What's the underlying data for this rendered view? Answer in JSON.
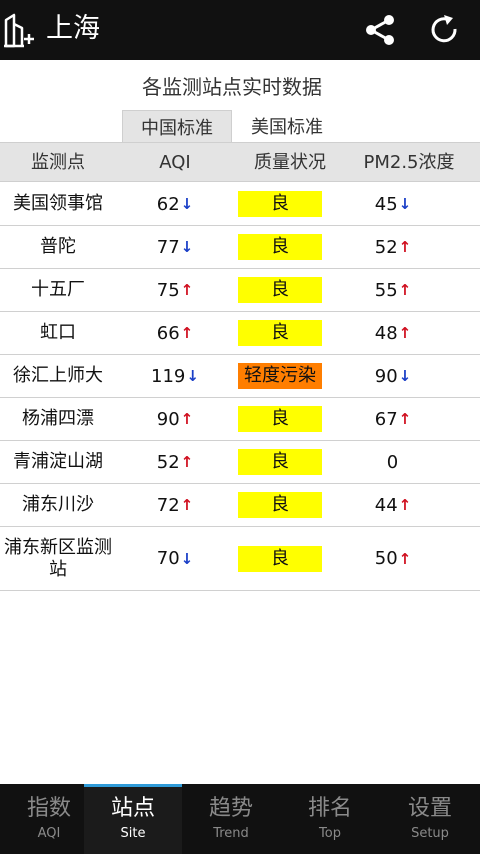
{
  "header": {
    "city": "上海",
    "icons": {
      "city": "add-city-icon",
      "share": "share-icon",
      "refresh": "refresh-icon"
    }
  },
  "subtitle": "各监测站点实时数据",
  "tabs": [
    {
      "label": "中国标准",
      "active": true
    },
    {
      "label": "美国标准",
      "active": false
    }
  ],
  "table": {
    "headers": [
      "监测点",
      "AQI",
      "质量状况",
      "PM2.5浓度"
    ],
    "rows": [
      {
        "name": "美国领事馆",
        "aqi": "62",
        "aqi_trend": "↓",
        "quality": "良",
        "quality_color": "#ffff00",
        "pm": "45",
        "pm_trend": "↓"
      },
      {
        "name": "普陀",
        "aqi": "77",
        "aqi_trend": "↓",
        "quality": "良",
        "quality_color": "#ffff00",
        "pm": "52",
        "pm_trend": "↑"
      },
      {
        "name": "十五厂",
        "aqi": "75",
        "aqi_trend": "↑",
        "quality": "良",
        "quality_color": "#ffff00",
        "pm": "55",
        "pm_trend": "↑"
      },
      {
        "name": "虹口",
        "aqi": "66",
        "aqi_trend": "↑",
        "quality": "良",
        "quality_color": "#ffff00",
        "pm": "48",
        "pm_trend": "↑"
      },
      {
        "name": "徐汇上师大",
        "aqi": "119",
        "aqi_trend": "↓",
        "quality": "轻度污染",
        "quality_color": "#ff7e00",
        "pm": "90",
        "pm_trend": "↓"
      },
      {
        "name": "杨浦四漂",
        "aqi": "90",
        "aqi_trend": "↑",
        "quality": "良",
        "quality_color": "#ffff00",
        "pm": "67",
        "pm_trend": "↑"
      },
      {
        "name": "青浦淀山湖",
        "aqi": "52",
        "aqi_trend": "↑",
        "quality": "良",
        "quality_color": "#ffff00",
        "pm": "0",
        "pm_trend": ""
      },
      {
        "name": "浦东川沙",
        "aqi": "72",
        "aqi_trend": "↑",
        "quality": "良",
        "quality_color": "#ffff00",
        "pm": "44",
        "pm_trend": "↑"
      },
      {
        "name": "浦东新区监测站",
        "aqi": "70",
        "aqi_trend": "↓",
        "quality": "良",
        "quality_color": "#ffff00",
        "pm": "50",
        "pm_trend": "↑"
      }
    ]
  },
  "nav": [
    {
      "zh": "指数",
      "en": "AQI",
      "active": false
    },
    {
      "zh": "站点",
      "en": "Site",
      "active": true
    },
    {
      "zh": "趋势",
      "en": "Trend",
      "active": false
    },
    {
      "zh": "排名",
      "en": "Top",
      "active": false
    },
    {
      "zh": "设置",
      "en": "Setup",
      "active": false
    }
  ],
  "colors": {
    "bar": "#111111",
    "active_accent": "#2f9bd8",
    "trend_down": "#1a3fc7",
    "trend_up": "#d01020",
    "header_bg": "#e4e4e4"
  }
}
